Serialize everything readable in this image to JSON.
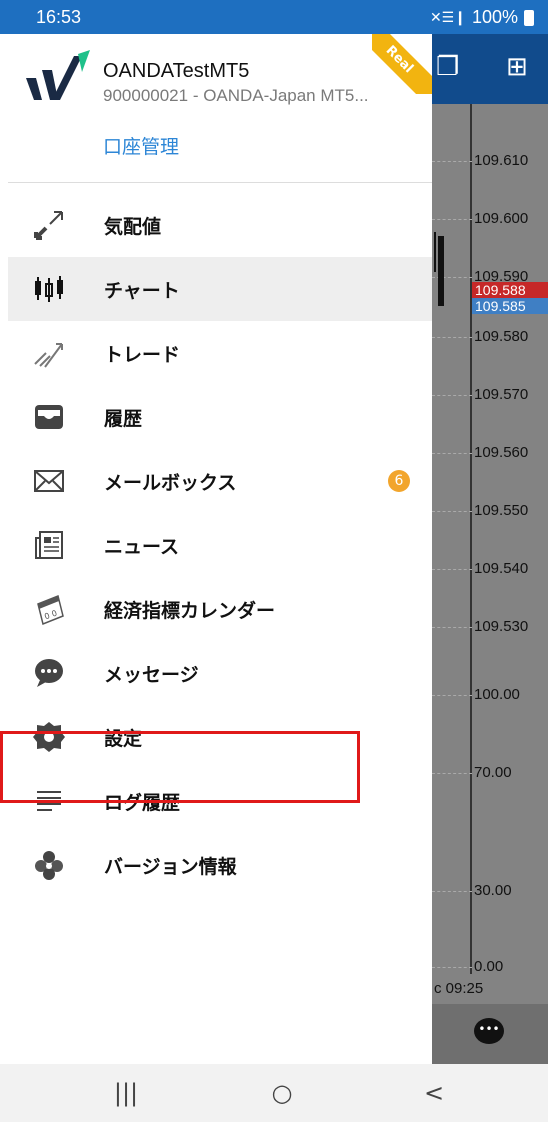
{
  "status_bar": {
    "time": "16:53",
    "signal_icons": "✕☰❙",
    "battery": "100%"
  },
  "account": {
    "name": "OANDATestMT5",
    "id_server": "900000021 - OANDA-Japan MT5...",
    "manage_link": "口座管理",
    "badge": "Real"
  },
  "menu": [
    {
      "label": "気配値",
      "icon": "quotes-arrows-icon",
      "active": false
    },
    {
      "label": "チャート",
      "icon": "candlestick-chart-icon",
      "active": true
    },
    {
      "label": "トレード",
      "icon": "trade-trend-icon",
      "active": false
    },
    {
      "label": "履歴",
      "icon": "history-inbox-icon",
      "active": false
    },
    {
      "label": "メールボックス",
      "icon": "mail-envelope-icon",
      "active": false,
      "badge": "6"
    },
    {
      "label": "ニュース",
      "icon": "news-icon",
      "active": false
    },
    {
      "label": "経済指標カレンダー",
      "icon": "calendar-icon",
      "active": false
    },
    {
      "label": "メッセージ",
      "icon": "message-bubble-icon",
      "active": false
    },
    {
      "label": "設定",
      "icon": "gear-icon",
      "active": false
    },
    {
      "label": "ログ履歴",
      "icon": "log-lines-icon",
      "active": false
    },
    {
      "label": "バージョン情報",
      "icon": "version-info-icon",
      "active": false
    }
  ],
  "chart": {
    "ticks": [
      "109.610",
      "109.600",
      "109.590",
      "109.580",
      "109.570",
      "109.560",
      "109.550",
      "109.540",
      "109.530",
      "100.00",
      "70.00",
      "30.00",
      "0.00"
    ],
    "price_bid": "109.588",
    "price_ask": "109.585",
    "time_label": "c 09:25"
  },
  "nav_bar": {
    "recents": "|||",
    "home": "○",
    "back": "<"
  }
}
